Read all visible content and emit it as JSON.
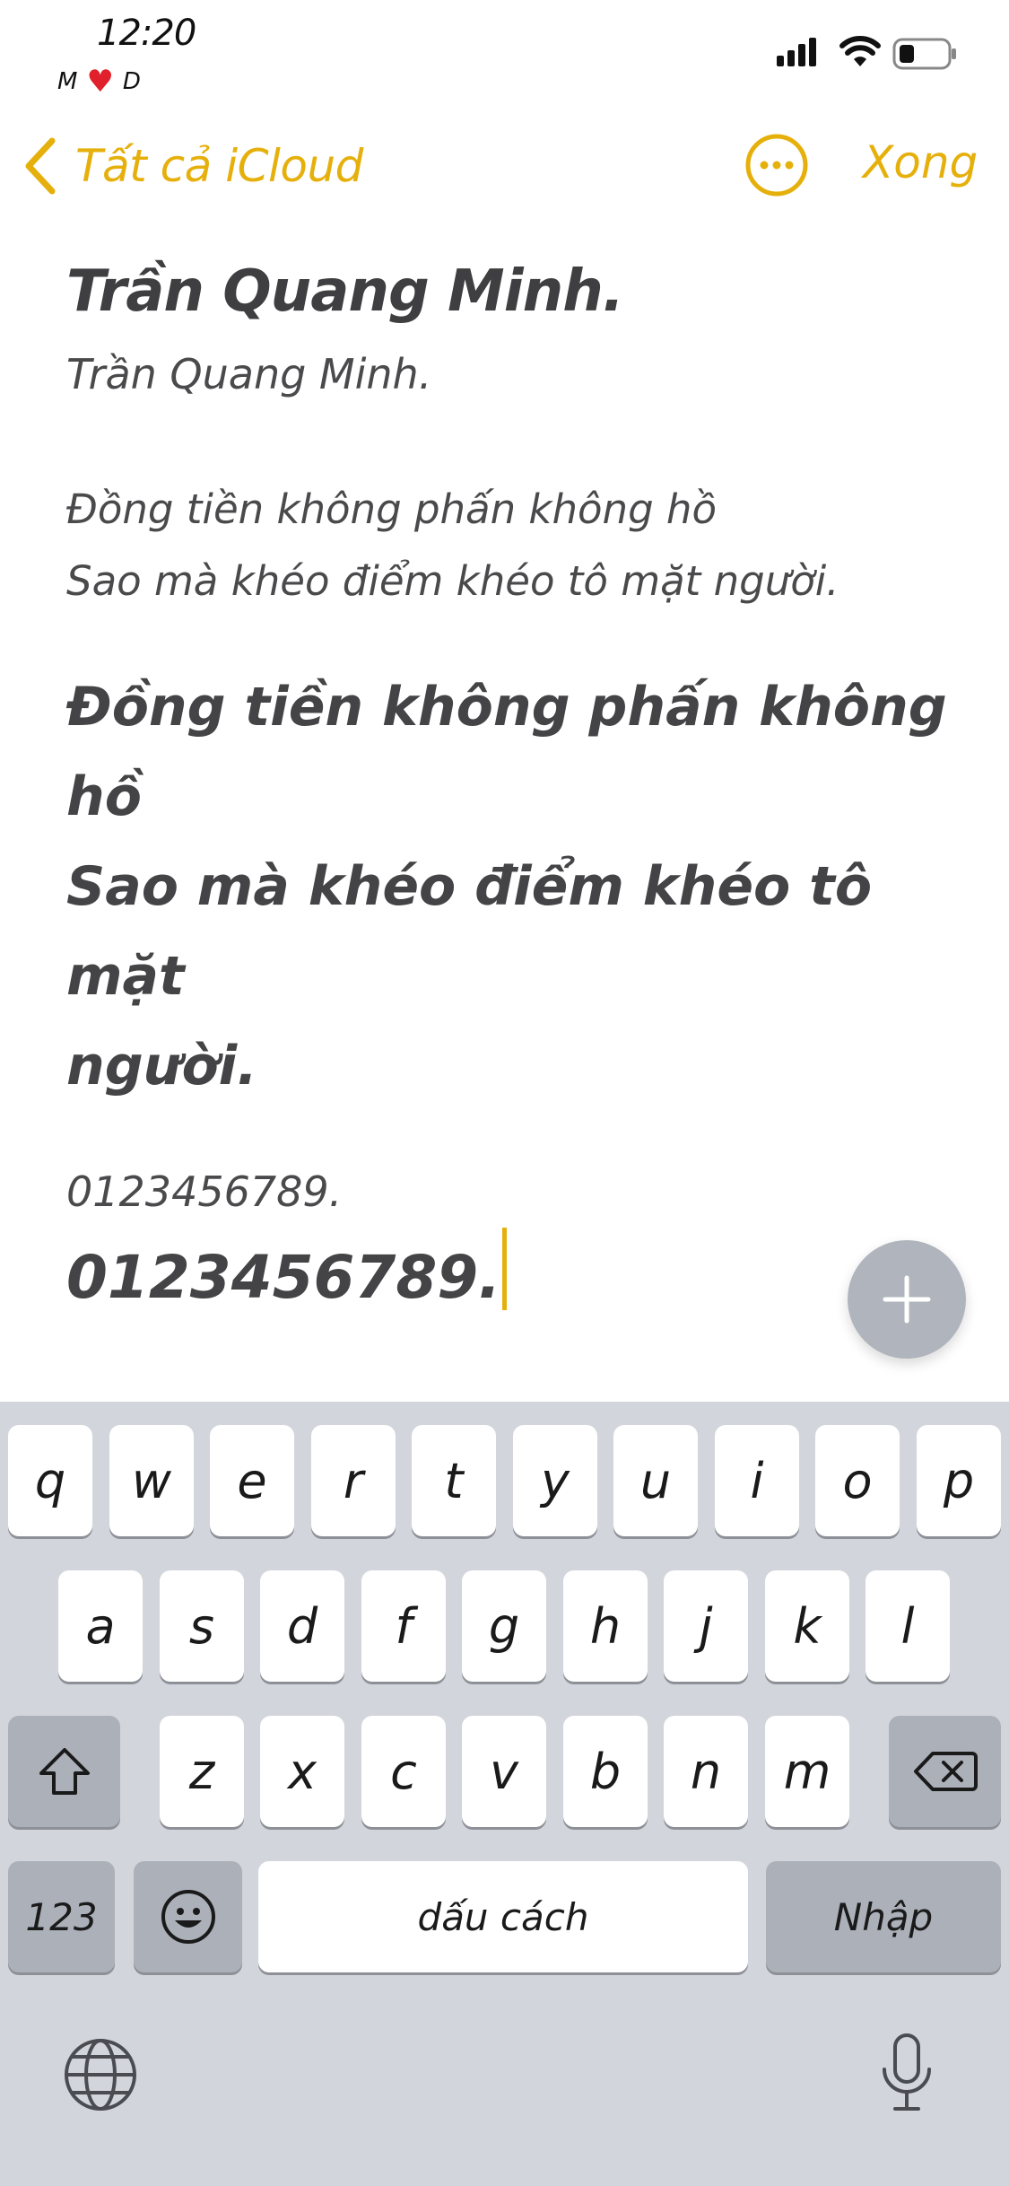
{
  "status_bar": {
    "time": "12:20",
    "carrier_left": "M",
    "carrier_right": "D",
    "icons": [
      "signal-icon",
      "wifi-icon",
      "battery-icon"
    ]
  },
  "nav": {
    "back_label": "Tất cả iCloud",
    "done_label": "Xong",
    "accent_color": "#e6b00c"
  },
  "note": {
    "title": "Trần Quang Minh.",
    "subtitle": "Trần Quang Minh.",
    "verse_small_line1": "Đồng tiền không phấn không hồ",
    "verse_small_line2": "Sao mà khéo điểm khéo tô mặt người.",
    "verse_large_line1": "Đồng tiền không phấn không hồ",
    "verse_large_line2": "Sao mà khéo điểm khéo tô mặt",
    "verse_large_line3": "người.",
    "number_small": "0123456789.",
    "number_large": "0123456789."
  },
  "keyboard": {
    "row1": [
      "q",
      "w",
      "e",
      "r",
      "t",
      "y",
      "u",
      "i",
      "o",
      "p"
    ],
    "row2": [
      "a",
      "s",
      "d",
      "f",
      "g",
      "h",
      "j",
      "k",
      "l"
    ],
    "row3": [
      "z",
      "x",
      "c",
      "v",
      "b",
      "n",
      "m"
    ],
    "numbers_label": "123",
    "space_label": "dấu cách",
    "return_label": "Nhập"
  }
}
